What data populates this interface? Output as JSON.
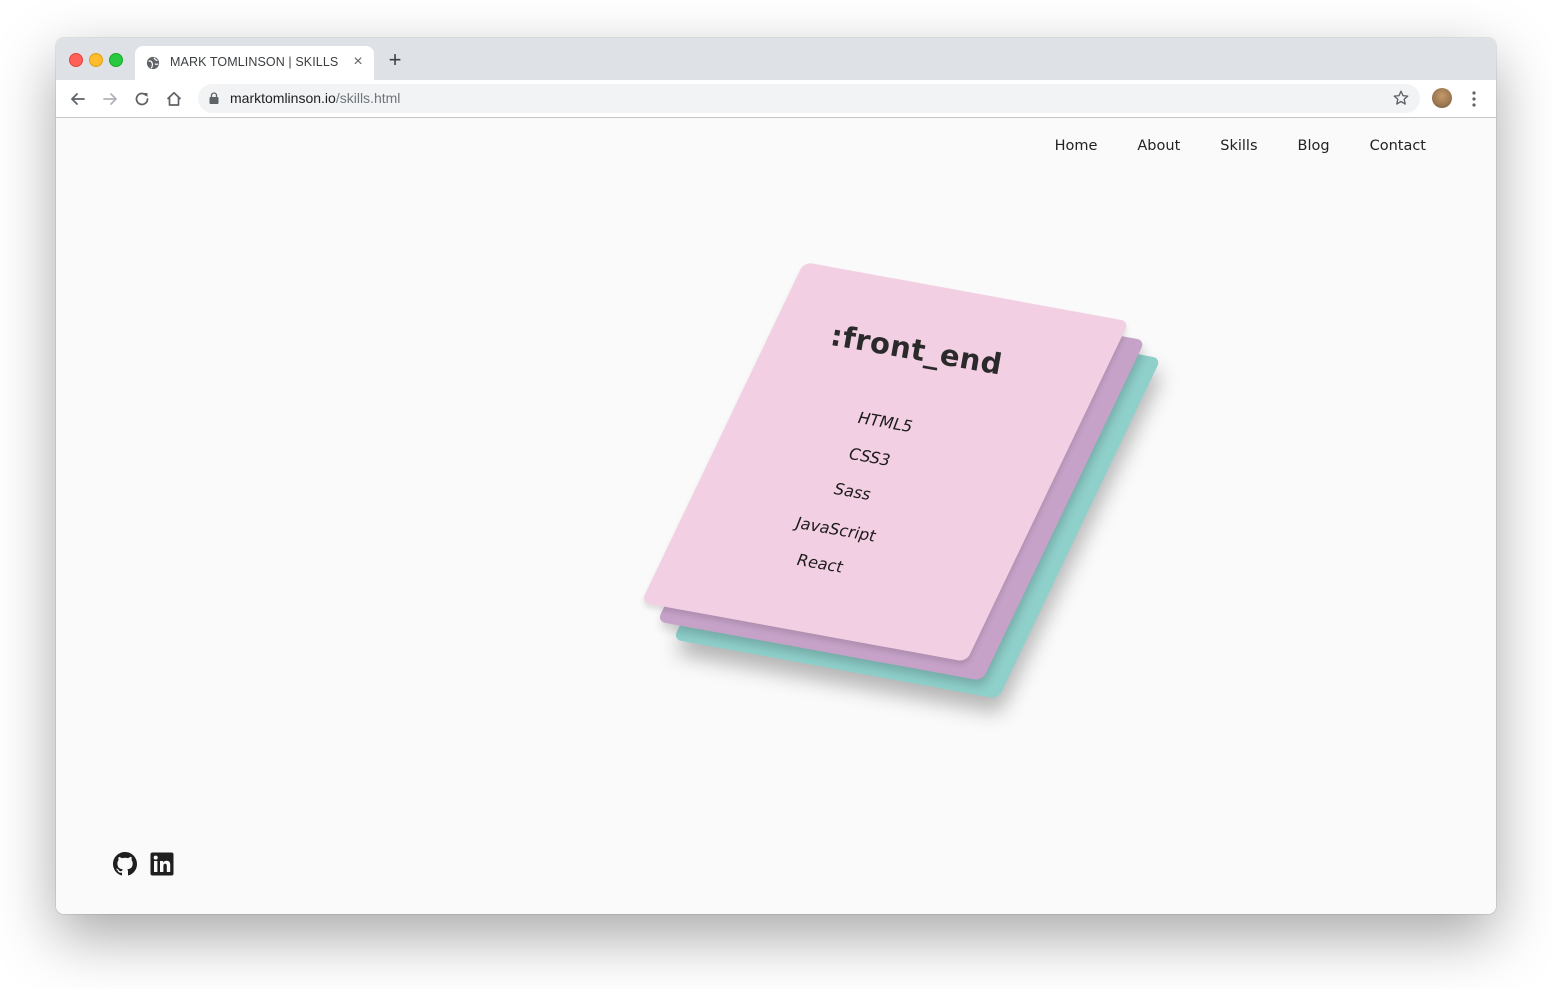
{
  "browser": {
    "tab_title": "MARK TOMLINSON | SKILLS",
    "tab_close": "×",
    "new_tab": "+",
    "url_domain": "marktomlinson.io",
    "url_path": "/skills.html"
  },
  "nav": {
    "items": [
      {
        "label": "Home"
      },
      {
        "label": "About"
      },
      {
        "label": "Skills"
      },
      {
        "label": "Blog"
      },
      {
        "label": "Contact"
      }
    ]
  },
  "card": {
    "title": ":front_end",
    "skills": [
      "HTML5",
      "CSS3",
      "Sass",
      "JavaScript",
      "React"
    ],
    "colors": {
      "front": "#f2cfe2",
      "middle": "#c6a2c8",
      "back": "#8fd0cb"
    }
  },
  "social": {
    "icons": [
      "github-icon",
      "linkedin-icon"
    ]
  }
}
